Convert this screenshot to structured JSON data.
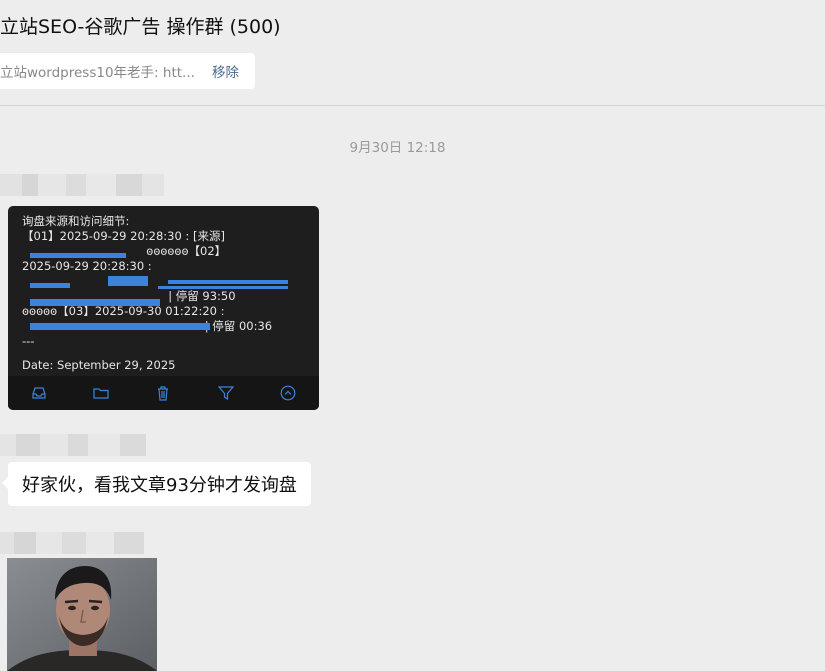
{
  "header": {
    "title": "立站SEO-谷歌广告 操作群 (500)",
    "pinned": {
      "text": "立站wordpress10年老手: htt...",
      "remove_label": "移除"
    }
  },
  "chat": {
    "timestamp": "9月30日 12:18",
    "messages": [
      {
        "type": "image",
        "lines": [
          "询盘来源和访问细节:",
          "【01】2025-09-29 20:28:30 : [来源]",
          "                                  ꙩꙩꙩꙩꙩꙩ【02】",
          "2025-09-29 20:28:30 :",
          "",
          "                                        | 停留 93:50",
          "ꙩꙩꙩꙩꙩ【03】2025-09-30 01:22:20 :",
          "                                                  | 停留 00:36",
          "---"
        ],
        "date_line": "Date: September 29, 2025",
        "toolbar_icons": [
          "inbox-icon",
          "folder-icon",
          "trash-icon",
          "filter-icon",
          "chevron-up-circle-icon"
        ]
      },
      {
        "type": "text",
        "text": "好家伙，看我文章93分钟才发询盘"
      },
      {
        "type": "photo"
      }
    ]
  },
  "colors": {
    "background": "#ededed",
    "bubble": "#ffffff",
    "link": "#4a6a8f",
    "image_bg": "#1e1e1f",
    "redaction": "#3b84d9"
  }
}
